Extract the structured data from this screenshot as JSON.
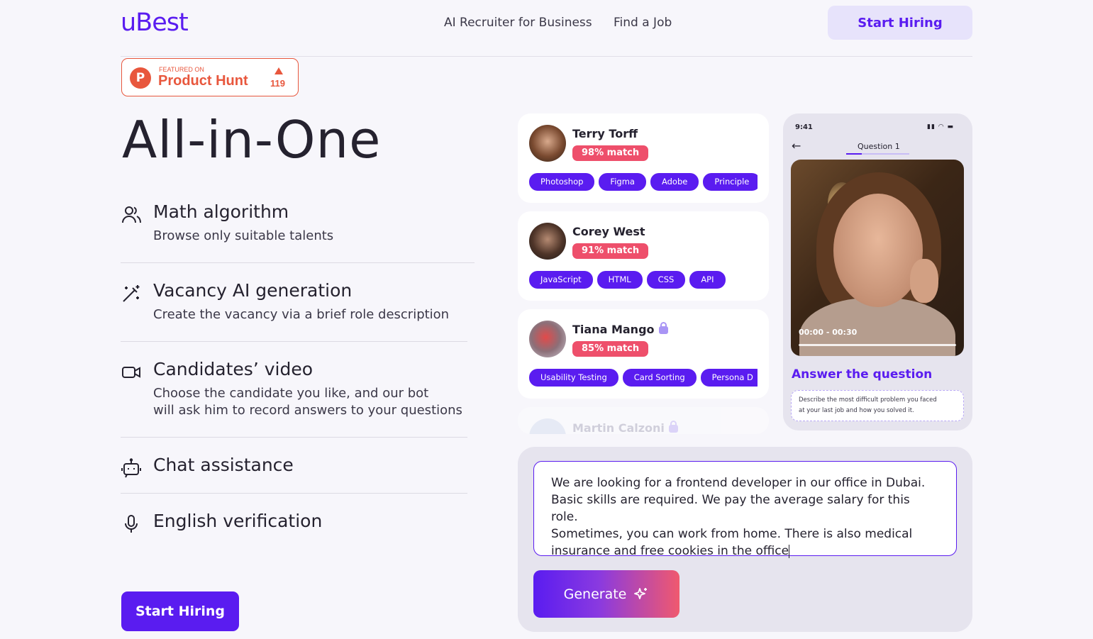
{
  "header": {
    "logo": "uBest",
    "nav": [
      "AI Recruiter for Business",
      "Find a Job"
    ],
    "cta": "Start Hiring"
  },
  "product_hunt": {
    "featured": "FEATURED ON",
    "name": "Product Hunt",
    "votes": "119",
    "color": "#e8573d"
  },
  "hero": {
    "title": "All-in-One",
    "cta": "Start Hiring"
  },
  "features": [
    {
      "title": "Math algorithm",
      "icon": "users-icon",
      "desc": [
        "Browse only suitable talents"
      ]
    },
    {
      "title": "Vacancy AI generation",
      "icon": "magic-wand-icon",
      "desc": [
        "Create the vacancy via a brief role description"
      ]
    },
    {
      "title": "Candidates’ video",
      "icon": "video-camera-icon",
      "desc": [
        "Choose the candidate you like, and our bot",
        "will ask him to record answers to your questions"
      ]
    },
    {
      "title": "Chat assistance",
      "icon": "robot-icon",
      "desc": []
    },
    {
      "title": "English verification",
      "icon": "microphone-icon",
      "desc": []
    }
  ],
  "candidates": [
    {
      "name": "Terry Torff",
      "match": "98% match",
      "locked": false,
      "tags": [
        "Photoshop",
        "Figma",
        "Adobe",
        "Principle"
      ]
    },
    {
      "name": "Corey West",
      "match": "91% match",
      "locked": false,
      "tags": [
        "JavaScript",
        "HTML",
        "CSS",
        "API"
      ]
    },
    {
      "name": "Tiana Mango",
      "match": "85% match",
      "locked": true,
      "tags": [
        "Usability Testing",
        "Card Sorting",
        "Persona D"
      ]
    },
    {
      "name": "Martin Calzoni",
      "locked": true
    }
  ],
  "phone": {
    "time": "9:41",
    "question": "Question 1",
    "progress": 0.25,
    "video_time": "00:00 - 00:30",
    "answer_title": "Answer the question",
    "answer_lines": [
      "Describe the most difficult problem you faced",
      "at your last job and how you solved it."
    ]
  },
  "generator": {
    "lines": [
      "We are looking for a frontend developer in our office in Dubai.",
      "Basic skills are required. We pay the average salary for this role.",
      "Sometimes, you can work from home. There is also medical",
      "insurance and free cookies in the office"
    ],
    "button": "Generate"
  },
  "colors": {
    "accent": "#5a1cf0",
    "match_badge": "#ee4f6b",
    "background": "#f7f6fb",
    "panel": "#e6e4ee"
  }
}
